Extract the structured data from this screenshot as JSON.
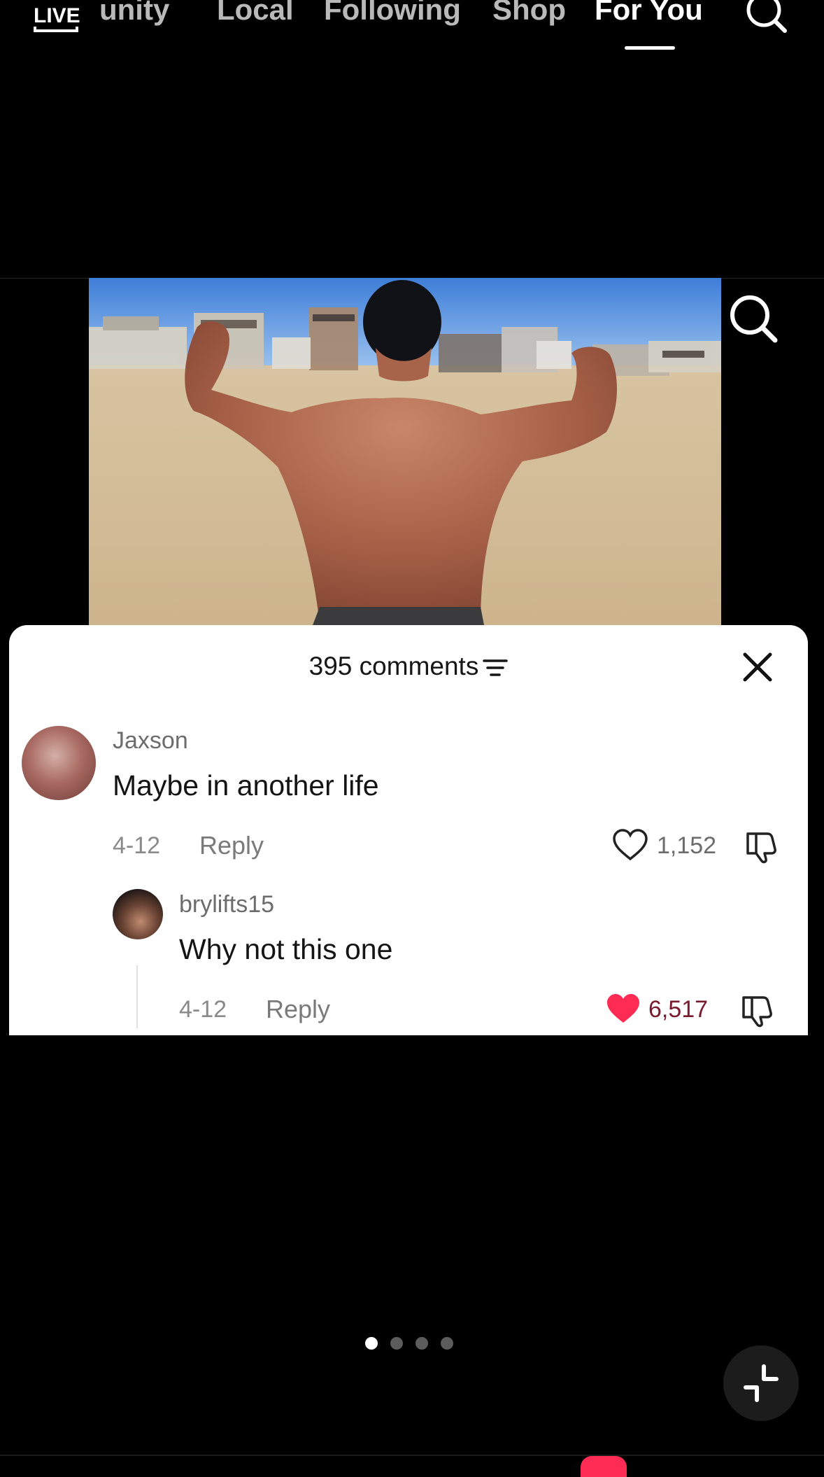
{
  "nav": {
    "live_label": "LIVE",
    "tabs": [
      {
        "label": "unity"
      },
      {
        "label": "Local"
      },
      {
        "label": "Following"
      },
      {
        "label": "Shop"
      },
      {
        "label": "For You",
        "active": true
      }
    ]
  },
  "comments_panel": {
    "count_label": "395 comments",
    "comments": [
      {
        "username": "Jaxson",
        "text": "Maybe in another life",
        "date": "4-12",
        "reply_label": "Reply",
        "likes": "1,152",
        "liked": false
      },
      {
        "username": "brylifts15",
        "text": "Why not this one",
        "date": "4-12",
        "reply_label": "Reply",
        "likes": "6,517",
        "liked": true
      }
    ]
  },
  "pagination": {
    "total": 4,
    "active_index": 0
  },
  "colors": {
    "background": "#000000",
    "sheet": "#ffffff",
    "like_active": "#fe2c55",
    "liked_count": "#7a1a2e",
    "sky": "#4f8be0",
    "sand": "#dcc6a2"
  },
  "icons": [
    "live-icon",
    "search-icon",
    "filter-icon",
    "close-icon",
    "heart-icon",
    "dislike-icon",
    "minimize-icon"
  ]
}
